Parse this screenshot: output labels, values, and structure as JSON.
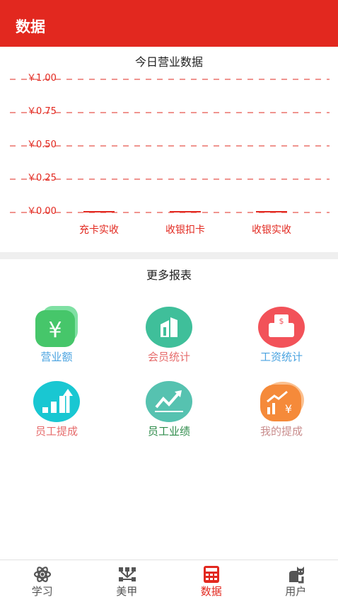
{
  "header": {
    "title": "数据"
  },
  "chart": {
    "title": "今日营业数据",
    "accent_color": "#e2281f",
    "y_tick_labels": [
      "￥1.00",
      "￥0.75",
      "￥0.50",
      "￥0.25",
      "￥0.00"
    ]
  },
  "chart_data": {
    "type": "bar",
    "title": "今日营业数据",
    "categories": [
      "充卡实收",
      "收银扣卡",
      "收银实收"
    ],
    "values": [
      0,
      0,
      0
    ],
    "ylim": [
      0,
      1
    ],
    "y_ticks": [
      1.0,
      0.75,
      0.5,
      0.25,
      0.0
    ],
    "grid": true,
    "grid_style": "dashed",
    "color": "#e2281f"
  },
  "reports": {
    "title": "更多报表",
    "items": [
      {
        "label": "营业额",
        "icon": "yen-cards-icon",
        "color": "#4aa3e0",
        "bg": "#46c66a"
      },
      {
        "label": "会员统计",
        "icon": "building-icon",
        "color": "#e66b6b",
        "bg": "#3fbf9a"
      },
      {
        "label": "工资统计",
        "icon": "wallet-icon",
        "color": "#4aa3e0",
        "bg": "#f25259"
      },
      {
        "label": "员工提成",
        "icon": "growth-bars-icon",
        "color": "#e66b6b",
        "bg": "#19c7d2"
      },
      {
        "label": "员工业绩",
        "icon": "trend-chart-icon",
        "color": "#2e8b4a",
        "bg": "#56c2b0"
      },
      {
        "label": "我的提成",
        "icon": "commission-icon",
        "color": "#c98d8d",
        "bg": "#f58a3a"
      }
    ]
  },
  "nav": {
    "items": [
      {
        "label": "学习",
        "icon": "atom-icon",
        "active": false
      },
      {
        "label": "美甲",
        "icon": "nail-nodes-icon",
        "active": false
      },
      {
        "label": "数据",
        "icon": "calculator-icon",
        "active": true
      },
      {
        "label": "用户",
        "icon": "cat-user-icon",
        "active": false
      }
    ],
    "active_color": "#e2281f",
    "inactive_color": "#555555"
  }
}
